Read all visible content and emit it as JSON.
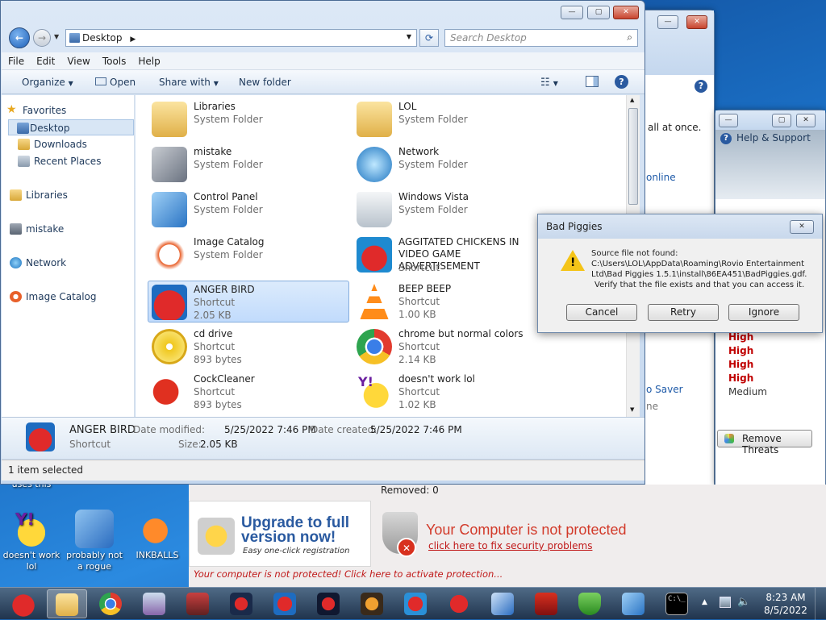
{
  "explorer": {
    "address": "Desktop",
    "search_placeholder": "Search Desktop",
    "menu": [
      "File",
      "Edit",
      "View",
      "Tools",
      "Help"
    ],
    "toolbar": {
      "organize": "Organize",
      "open": "Open",
      "share": "Share with",
      "new_folder": "New folder"
    },
    "nav": {
      "favorites": "Favorites",
      "desktop": "Desktop",
      "downloads": "Downloads",
      "recent": "Recent Places",
      "libraries": "Libraries",
      "mistake": "mistake",
      "network": "Network",
      "image_catalog": "Image Catalog"
    },
    "files": [
      {
        "name": "Libraries",
        "type": "System Folder",
        "size": ""
      },
      {
        "name": "LOL",
        "type": "System Folder",
        "size": ""
      },
      {
        "name": "mistake",
        "type": "System Folder",
        "size": ""
      },
      {
        "name": "Network",
        "type": "System Folder",
        "size": ""
      },
      {
        "name": "Control Panel",
        "type": "System Folder",
        "size": ""
      },
      {
        "name": "Windows Vista",
        "type": "System Folder",
        "size": ""
      },
      {
        "name": "Image Catalog",
        "type": "System Folder",
        "size": ""
      },
      {
        "name": "AGGITATED CHICKENS IN VIDEO GAME ADVERTISEMENT",
        "type": "Shortcut",
        "size": ""
      },
      {
        "name": "ANGER BIRD",
        "type": "Shortcut",
        "size": "2.05 KB"
      },
      {
        "name": "BEEP BEEP",
        "type": "Shortcut",
        "size": "1.00 KB"
      },
      {
        "name": "cd drive",
        "type": "Shortcut",
        "size": "893 bytes"
      },
      {
        "name": "chrome but normal colors",
        "type": "Shortcut",
        "size": "2.14 KB"
      },
      {
        "name": "CockCleaner",
        "type": "Shortcut",
        "size": "893 bytes"
      },
      {
        "name": "doesn't work lol",
        "type": "Shortcut",
        "size": "1.02 KB"
      }
    ],
    "details": {
      "name": "ANGER BIRD",
      "type": "Shortcut",
      "modified_label": "Date modified:",
      "modified": "5/25/2022 7:46 PM",
      "created_label": "Date created:",
      "created": "5/25/2022 7:46 PM",
      "size_label": "Size:",
      "size": "2.05 KB"
    },
    "status": "1 item selected"
  },
  "dialog": {
    "title": "Bad Piggies",
    "message_line1": "Source file not found:",
    "message_line2": "C:\\Users\\LOL\\AppData\\Roaming\\Rovio Entertainment",
    "message_line3": "Ltd\\Bad Piggies 1.5.1\\install\\86EA451\\BadPiggies.gdf.",
    "message_line4": "Verify that the file exists and that you can access it.",
    "cancel": "Cancel",
    "retry": "Retry",
    "ignore": "Ignore"
  },
  "back_window": {
    "fragment1": "all at once.",
    "fragment2": "online",
    "fragment3": "o Saver",
    "fragment4": "ne"
  },
  "help_window": {
    "title": "Help & Support",
    "threats": [
      "High",
      "High",
      "High",
      "High",
      "Medium"
    ],
    "remove_button": "Remove Threats"
  },
  "security": {
    "removed": "Removed: 0",
    "upgrade_title": "Upgrade to full version now!",
    "upgrade_sub": "Easy one-click registration",
    "warn_title": "Your Computer is not protected",
    "warn_link": "click here to fix security problems",
    "bottom": "Your computer is not protected! Click here to activate protection..."
  },
  "desktop_icons": [
    {
      "label": "uses this"
    },
    {
      "label": "doesn't work lol"
    },
    {
      "label": "probably not a rogue"
    },
    {
      "label": "INKBALLS"
    }
  ],
  "clock": {
    "time": "8:23 AM",
    "date": "8/5/2022"
  },
  "colors": {
    "high": "#c00000",
    "warn": "#d23a2a",
    "link": "#c01818",
    "title_blue": "#2a5aa0"
  }
}
